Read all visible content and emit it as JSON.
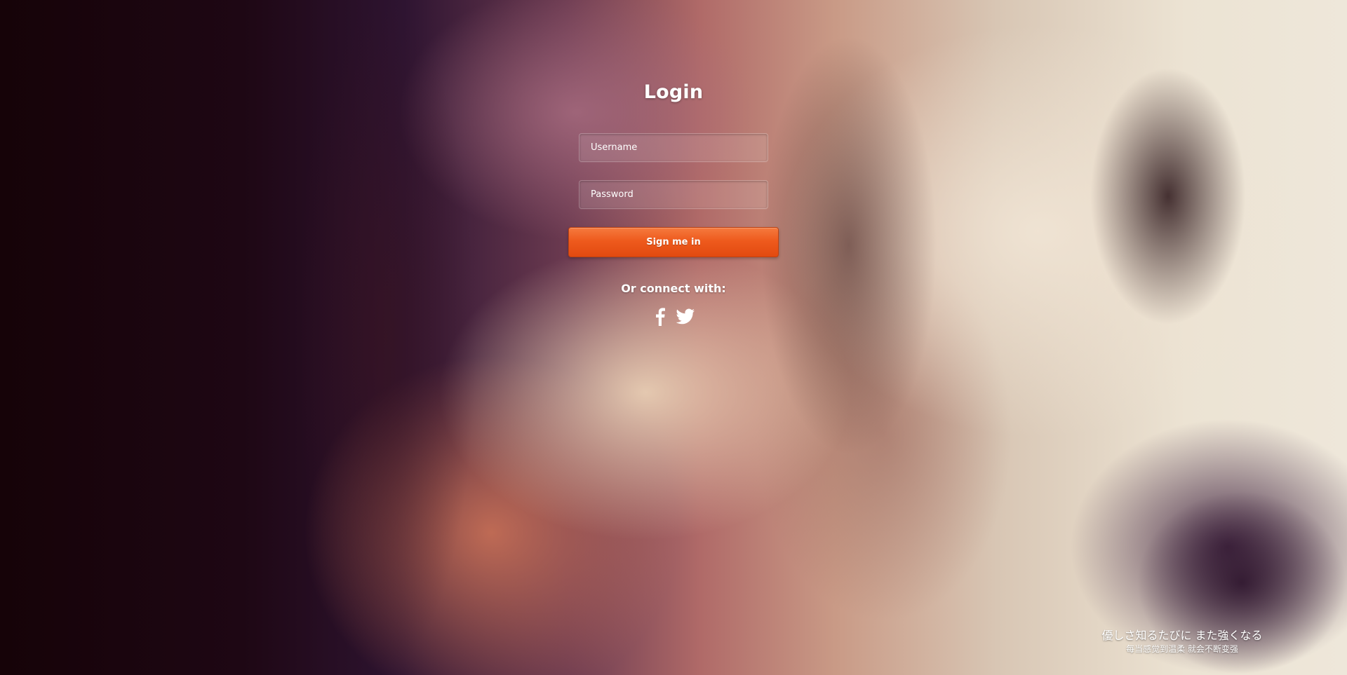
{
  "login": {
    "title": "Login",
    "username_placeholder": "Username",
    "password_placeholder": "Password",
    "submit_label": "Sign me in",
    "connect_label": "Or connect with:",
    "social": [
      {
        "icon": "facebook-icon"
      },
      {
        "icon": "twitter-icon"
      }
    ]
  },
  "quote": {
    "line1": "優しさ知るたびに また強くなる",
    "line2": "每当感觉到温柔 就会不断变强"
  },
  "colors": {
    "button": "#ee5a1d",
    "text": "#ffffff"
  }
}
